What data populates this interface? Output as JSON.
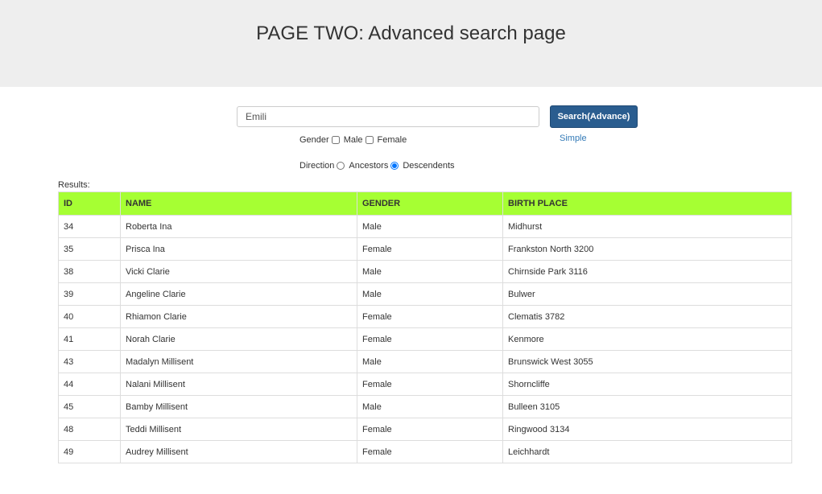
{
  "header": {
    "title": "PAGE TWO: Advanced search page"
  },
  "search": {
    "value": "Emili",
    "button_label": "Search(Advance)",
    "simple_link": "Simple"
  },
  "gender_filter": {
    "label": "Gender",
    "options": [
      {
        "label": "Male",
        "checked": false
      },
      {
        "label": "Female",
        "checked": false
      }
    ]
  },
  "direction_filter": {
    "label": "Direction",
    "options": [
      {
        "label": "Ancestors",
        "selected": false
      },
      {
        "label": "Descendents",
        "selected": true
      }
    ]
  },
  "results": {
    "label": "Results:",
    "columns": [
      "ID",
      "NAME",
      "GENDER",
      "BIRTH PLACE"
    ],
    "rows": [
      [
        "34",
        "Roberta Ina",
        "Male",
        "Midhurst"
      ],
      [
        "35",
        "Prisca Ina",
        "Female",
        "Frankston North 3200"
      ],
      [
        "38",
        "Vicki Clarie",
        "Male",
        "Chirnside Park 3116"
      ],
      [
        "39",
        "Angeline Clarie",
        "Male",
        "Bulwer"
      ],
      [
        "40",
        "Rhiamon Clarie",
        "Female",
        "Clematis 3782"
      ],
      [
        "41",
        "Norah Clarie",
        "Female",
        "Kenmore"
      ],
      [
        "43",
        "Madalyn Millisent",
        "Male",
        "Brunswick West 3055"
      ],
      [
        "44",
        "Nalani Millisent",
        "Female",
        "Shorncliffe"
      ],
      [
        "45",
        "Bamby Millisent",
        "Male",
        "Bulleen 3105"
      ],
      [
        "48",
        "Teddi Millisent",
        "Female",
        "Ringwood 3134"
      ],
      [
        "49",
        "Audrey Millisent",
        "Female",
        "Leichhardt"
      ]
    ]
  },
  "colors": {
    "header_bg": "#eeeeee",
    "table_header_bg": "#a6ff33",
    "button_bg": "#2a5d8f",
    "link": "#337ab7"
  }
}
